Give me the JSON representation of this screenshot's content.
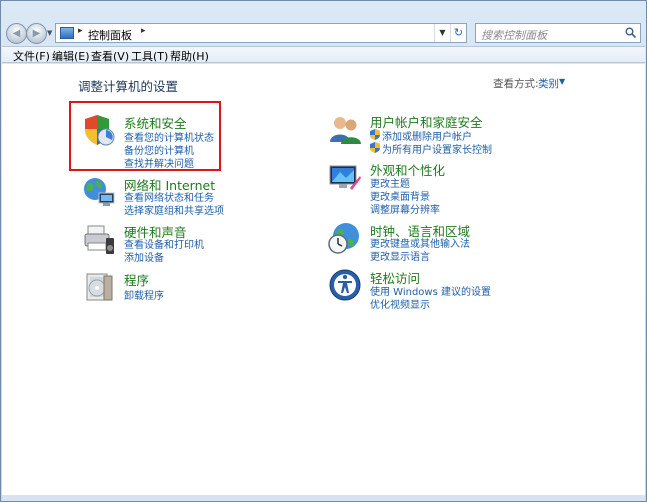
{
  "address_bar": {
    "path_label": "控制面板",
    "search_placeholder": "搜索控制面板"
  },
  "menu": {
    "items": [
      {
        "label": "文件(F)"
      },
      {
        "label": "编辑(E)"
      },
      {
        "label": "查看(V)"
      },
      {
        "label": "工具(T)"
      },
      {
        "label": "帮助(H)"
      }
    ]
  },
  "content": {
    "title": "调整计算机的设置",
    "view_by_label": "查看方式:",
    "view_by_value": "类别"
  },
  "categories_left": [
    {
      "title": "系统和安全",
      "icon": "system-security-icon",
      "links": [
        "查看您的计算机状态",
        "备份您的计算机",
        "查找并解决问题"
      ]
    },
    {
      "title": "网络和 Internet",
      "icon": "network-icon",
      "links": [
        "查看网络状态和任务",
        "选择家庭组和共享选项"
      ]
    },
    {
      "title": "硬件和声音",
      "icon": "hardware-sound-icon",
      "links": [
        "查看设备和打印机",
        "添加设备"
      ]
    },
    {
      "title": "程序",
      "icon": "programs-icon",
      "links": [
        "卸载程序"
      ]
    }
  ],
  "categories_right": [
    {
      "title": "用户帐户和家庭安全",
      "icon": "user-accounts-icon",
      "links": [
        "添加或删除用户帐户",
        "为所有用户设置家长控制"
      ]
    },
    {
      "title": "外观和个性化",
      "icon": "appearance-icon",
      "links": [
        "更改主题",
        "更改桌面背景",
        "调整屏幕分辨率"
      ]
    },
    {
      "title": "时钟、语言和区域",
      "icon": "clock-region-icon",
      "links": [
        "更改键盘或其他输入法",
        "更改显示语言"
      ]
    },
    {
      "title": "轻松访问",
      "icon": "ease-of-access-icon",
      "links": [
        "使用 Windows 建议的设置",
        "优化视频显示"
      ]
    }
  ],
  "colors": {
    "category_title": "#1e7a1e",
    "link": "#1f5fa8",
    "highlight_border": "#e0141c"
  }
}
